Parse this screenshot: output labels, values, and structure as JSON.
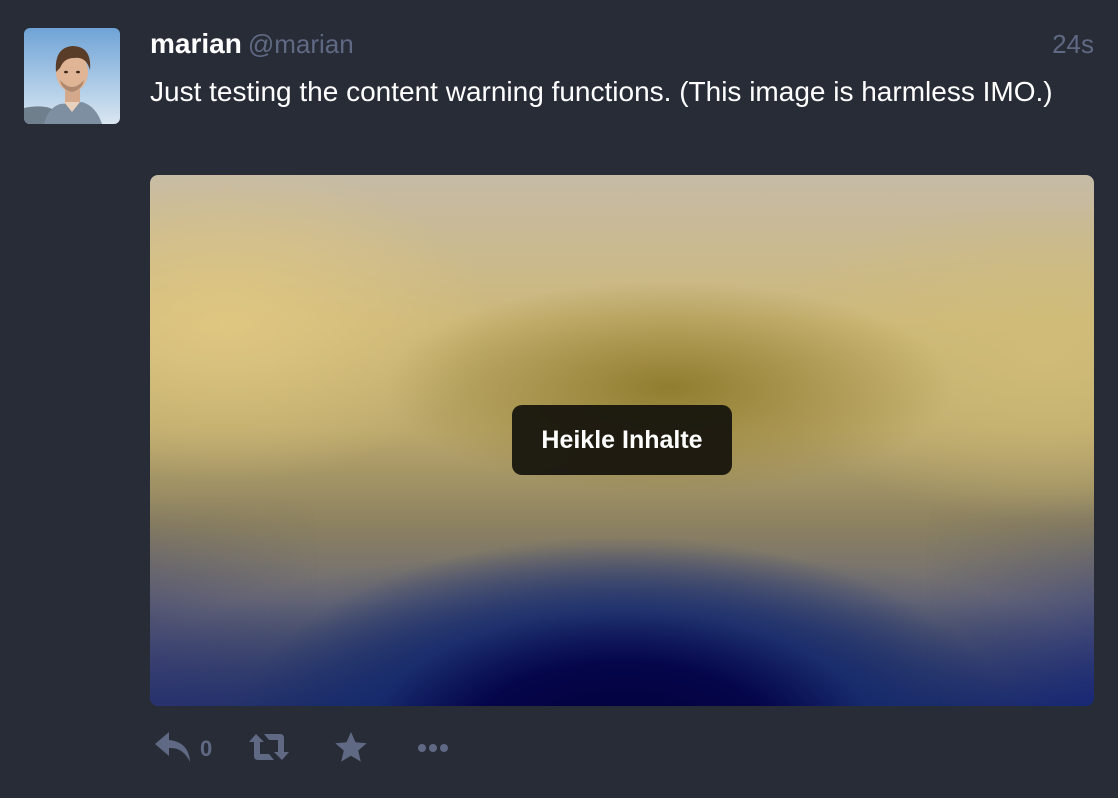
{
  "status": {
    "author": {
      "display_name": "marian",
      "handle": "@marian"
    },
    "timestamp": "24s",
    "content": "Just testing the content warning functions. (This image is harmless IMO.)",
    "media": {
      "sensitive_label": "Heikle Inhalte"
    },
    "actions": {
      "reply_count": "0",
      "icons": [
        "reply-icon",
        "boost-icon",
        "star-icon",
        "ellipsis-icon"
      ]
    }
  },
  "colors": {
    "background": "#282c37",
    "muted_text": "#606984",
    "text": "#ffffff"
  }
}
